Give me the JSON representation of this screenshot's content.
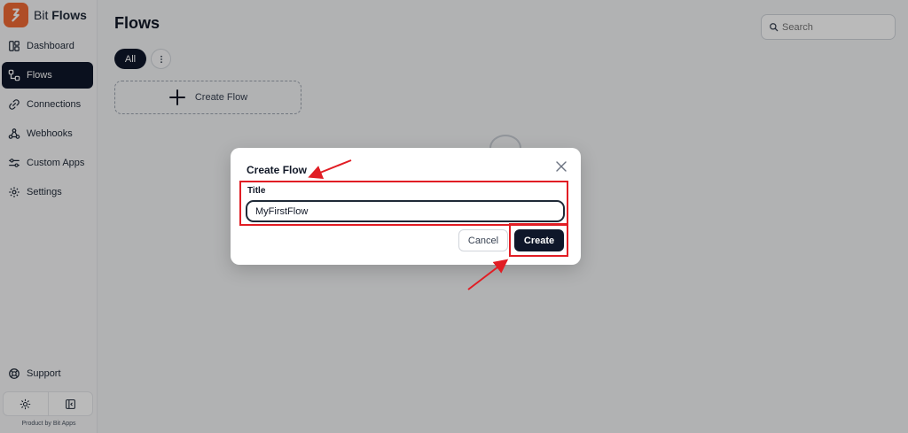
{
  "brand": {
    "name_light": "Bit ",
    "name_bold": "Flows"
  },
  "sidebar": {
    "items": [
      {
        "label": "Dashboard",
        "icon": "dashboard-icon",
        "active": false
      },
      {
        "label": "Flows",
        "icon": "flows-icon",
        "active": true
      },
      {
        "label": "Connections",
        "icon": "link-icon",
        "active": false
      },
      {
        "label": "Webhooks",
        "icon": "webhook-icon",
        "active": false
      },
      {
        "label": "Custom Apps",
        "icon": "sliders-icon",
        "active": false
      },
      {
        "label": "Settings",
        "icon": "gear-icon",
        "active": false
      }
    ],
    "support_label": "Support",
    "footer": "Product by Bit Apps"
  },
  "main": {
    "title": "Flows",
    "search": {
      "placeholder": "Search",
      "value": ""
    },
    "filter_all": "All",
    "create_flow_card": "Create Flow"
  },
  "modal": {
    "title": "Create Flow",
    "field_label": "Title",
    "field_value": "MyFirstFlow",
    "cancel_label": "Cancel",
    "create_label": "Create"
  },
  "colors": {
    "accent_dark": "#0f172a",
    "brand_orange": "#f06a35",
    "annotation_red": "#e11d24"
  }
}
